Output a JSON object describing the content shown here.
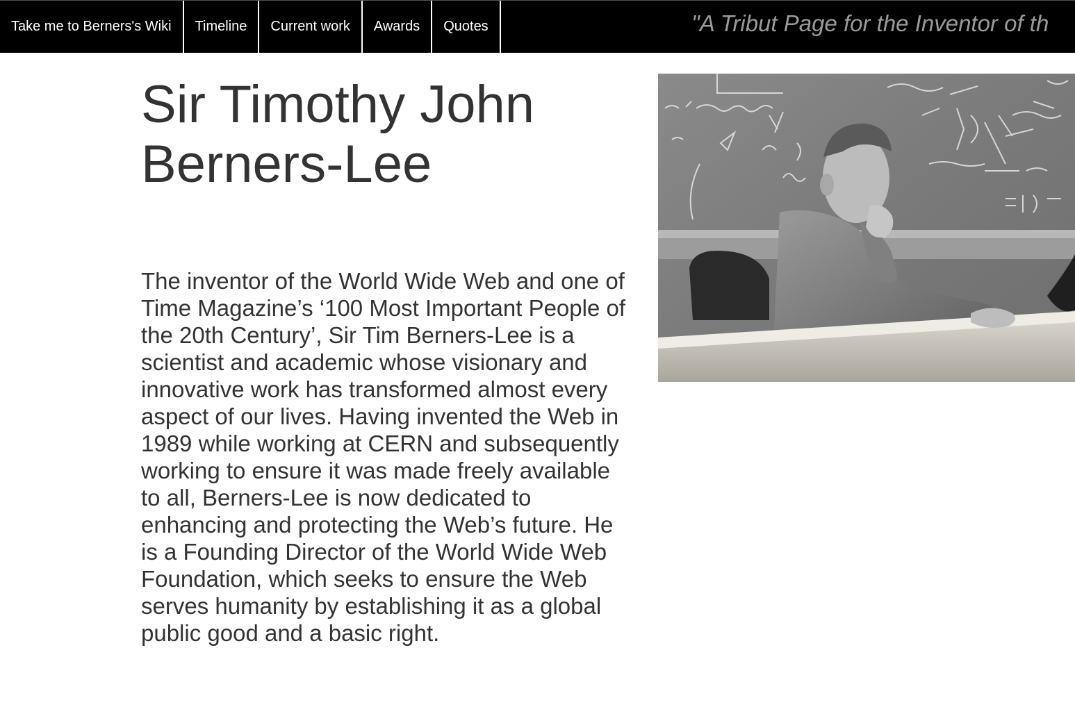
{
  "nav": {
    "links": [
      {
        "label": "Take me to Berners's Wiki"
      },
      {
        "label": "Timeline"
      },
      {
        "label": "Current work"
      },
      {
        "label": "Awards"
      },
      {
        "label": "Quotes"
      }
    ],
    "tagline": "\"A Tribut Page for the Inventor of th"
  },
  "main": {
    "title": "Sir Timothy John Berners-Lee",
    "bio": "The inventor of the World Wide Web and one of Time Magazine’s ‘100 Most Important People of the 20th Century’, Sir Tim Berners-Lee is a scientist and academic whose visionary and innovative work has transformed almost every aspect of our lives. Having invented the Web in 1989 while working at CERN and subsequently working to ensure it was made freely available to all, Berners-Lee is now dedicated to enhancing and protecting the Web’s future. He is a Founding Director of the World Wide Web Foundation, which seeks to ensure the Web serves humanity by establishing it as a global public good and a basic right."
  },
  "colors": {
    "navbar_bg": "#000000",
    "nav_text": "#ffffff",
    "tagline_text": "#9a9a9a",
    "body_text": "#333333"
  }
}
